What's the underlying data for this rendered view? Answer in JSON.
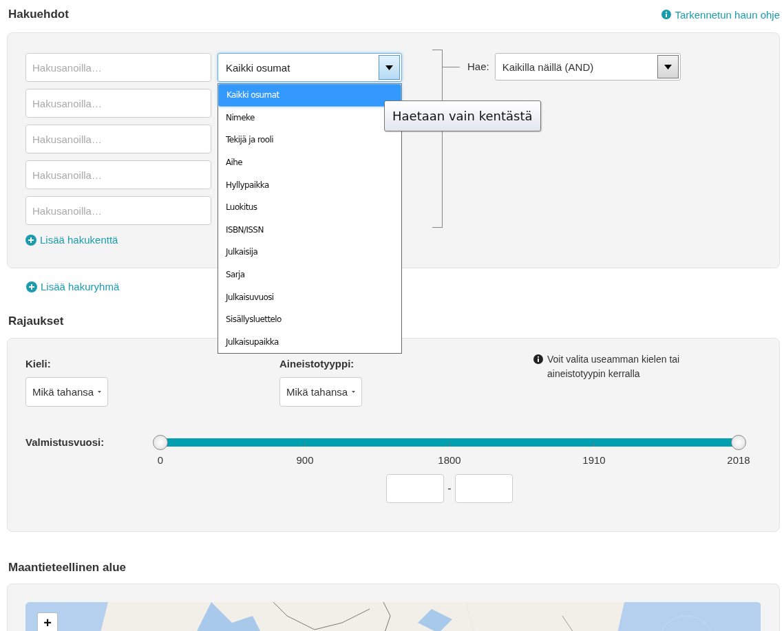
{
  "help_link": {
    "label": "Tarkennetun haun ohje"
  },
  "search_conditions": {
    "heading": "Hakuehdot",
    "term_fields": [
      {
        "placeholder": "Hakusanoilla…"
      },
      {
        "placeholder": "Hakusanoilla…"
      },
      {
        "placeholder": "Hakusanoilla…"
      },
      {
        "placeholder": "Hakusanoilla…"
      },
      {
        "placeholder": "Hakusanoilla…"
      }
    ],
    "field_select": {
      "value": "Kaikki osumat",
      "expanded": true,
      "options": [
        {
          "label": "Kaikki osumat",
          "selected": true
        },
        {
          "label": "Nimeke",
          "selected": false
        },
        {
          "label": "Tekijä ja rooli",
          "selected": false
        },
        {
          "label": "Aihe",
          "selected": false
        },
        {
          "label": "Hyllypaikka",
          "selected": false
        },
        {
          "label": "Luokitus",
          "selected": false
        },
        {
          "label": "ISBN/ISSN",
          "selected": false
        },
        {
          "label": "Julkaisija",
          "selected": false
        },
        {
          "label": "Sarja",
          "selected": false
        },
        {
          "label": "Julkaisuvuosi",
          "selected": false
        },
        {
          "label": "Sisällysluettelo",
          "selected": false
        },
        {
          "label": "Julkaisupaikka",
          "selected": false
        }
      ]
    },
    "tooltip": "Haetaan vain kentästä",
    "operator": {
      "label": "Hae:",
      "value": "Kaikilla näillä (AND)"
    },
    "add_field": "Lisää hakukenttä"
  },
  "add_group": "Lisää hakuryhmä",
  "filters": {
    "heading": "Rajaukset",
    "selects": [
      {
        "label": "Kieli:",
        "value": "Mikä tahansa"
      },
      {
        "label": "Aineistotyyppi:",
        "value": "Mikä tahansa"
      }
    ],
    "note": "Voit valita useamman kielen tai aineistotyypin kerralla",
    "year": {
      "label": "Valmistusvuosi:",
      "ticks": [
        "0",
        "900",
        "1800",
        "1910",
        "2018"
      ],
      "separator": "-"
    }
  },
  "geographic": {
    "heading": "Maantieteellinen alue",
    "zoom_in": "+"
  }
}
